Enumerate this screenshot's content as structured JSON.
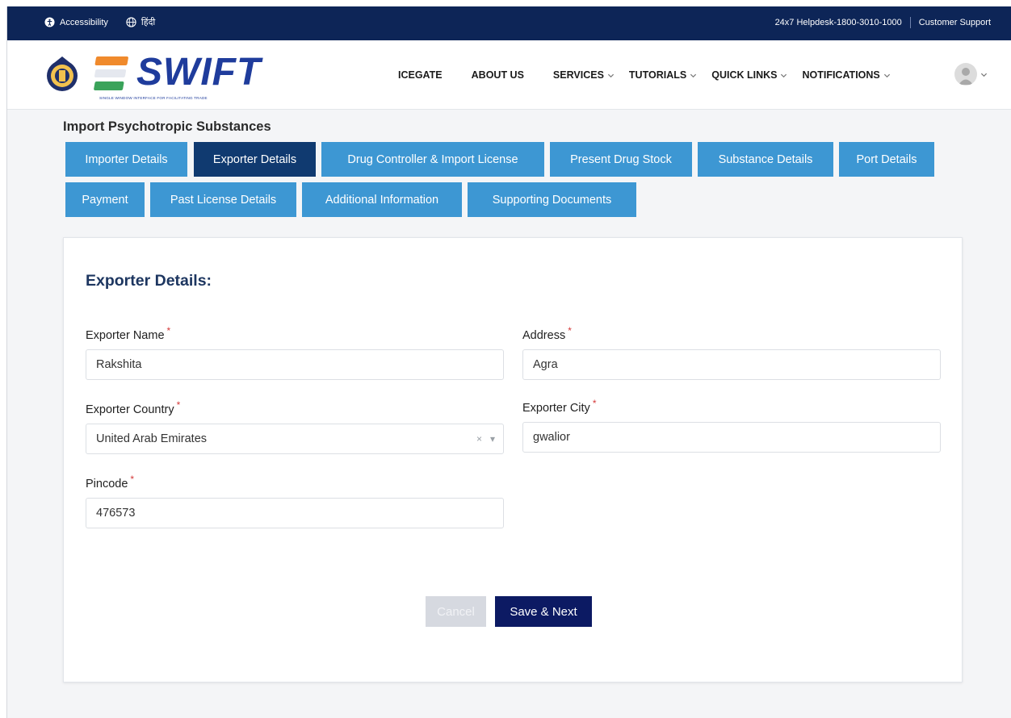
{
  "topbar": {
    "accessibility_label": "Accessibility",
    "language_label": "हिंदी",
    "helpdesk_label": "24x7 Helpdesk-1800-3010-1000",
    "support_label": "Customer Support"
  },
  "brand": {
    "name": "SWIFT",
    "tagline": "SINGLE WINDOW INTERFACE FOR FACILITATING TRADE"
  },
  "nav": {
    "items": [
      {
        "label": "ICEGATE"
      },
      {
        "label": "ABOUT US"
      },
      {
        "label": "SERVICES"
      },
      {
        "label": "TUTORIALS"
      },
      {
        "label": "QUICK LINKS"
      },
      {
        "label": "NOTIFICATIONS"
      }
    ]
  },
  "page": {
    "title": "Import Psychotropic Substances"
  },
  "tabs": [
    {
      "label": "Importer Details"
    },
    {
      "label": "Exporter Details"
    },
    {
      "label": "Drug Controller & Import License"
    },
    {
      "label": "Present Drug Stock"
    },
    {
      "label": "Substance Details"
    },
    {
      "label": "Port Details"
    },
    {
      "label": "Payment"
    },
    {
      "label": "Past License Details"
    },
    {
      "label": "Additional Information"
    },
    {
      "label": "Supporting Documents"
    }
  ],
  "form": {
    "title": "Exporter Details:",
    "exporter_name": {
      "label": "Exporter Name",
      "value": "Rakshita"
    },
    "address": {
      "label": "Address",
      "value": "Agra"
    },
    "exporter_country": {
      "label": "Exporter Country",
      "value": "United Arab Emirates"
    },
    "exporter_city": {
      "label": "Exporter City",
      "value": "gwalior"
    },
    "pincode": {
      "label": "Pincode",
      "value": "476573"
    },
    "required_mark": "*"
  },
  "actions": {
    "cancel_label": "Cancel",
    "save_label": "Save & Next"
  },
  "colors": {
    "topbar": "#0d2557",
    "tab": "#3d97d3",
    "tab_active": "#103a70",
    "primary_button": "#0c1a63"
  }
}
